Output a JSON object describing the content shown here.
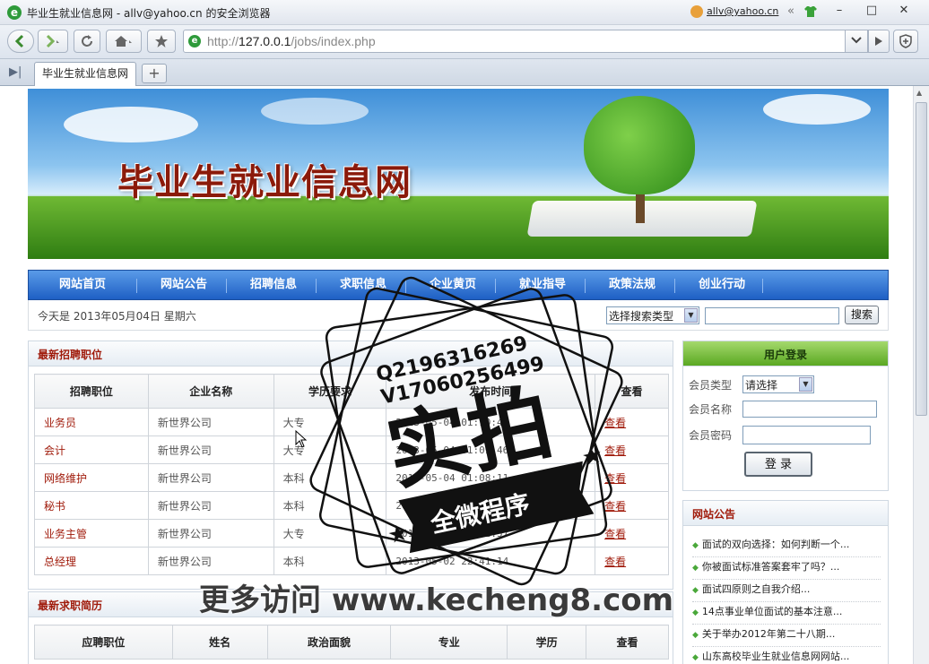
{
  "window": {
    "title": "毕业生就业信息网 - allv@yahoo.cn 的安全浏览器",
    "user_email": "allv@yahoo.cn",
    "collapse_glyph": "«"
  },
  "browser": {
    "url_prefix": "http://",
    "url_host": "127.0.0.1",
    "url_path": "/jobs/index.php",
    "tab_label": "毕业生就业信息网",
    "new_tab_label": "+"
  },
  "site": {
    "banner_title": "毕业生就业信息网",
    "menu": [
      "网站首页",
      "网站公告",
      "招聘信息",
      "求职信息",
      "企业黄页",
      "就业指导",
      "政策法规",
      "创业行动"
    ],
    "today_text": "今天是 2013年05月04日 星期六",
    "search_select": "选择搜索类型",
    "search_button": "搜索"
  },
  "jobs_panel": {
    "title": "最新招聘职位",
    "columns": [
      "招聘职位",
      "企业名称",
      "学历要求",
      "发布时间",
      "查看"
    ],
    "rows": [
      [
        "业务员",
        "新世界公司",
        "大专",
        "2013-05-04 01:10:43",
        "查看"
      ],
      [
        "会计",
        "新世界公司",
        "大专",
        "2013-05-04 01:09:46",
        "查看"
      ],
      [
        "网络维护",
        "新世界公司",
        "本科",
        "2013-05-04 01:08:11",
        "查看"
      ],
      [
        "秘书",
        "新世界公司",
        "本科",
        "2013-05-04 01:08:30",
        "查看"
      ],
      [
        "业务主管",
        "新世界公司",
        "大专",
        "2013-05-02 22:42:57",
        "查看"
      ],
      [
        "总经理",
        "新世界公司",
        "本科",
        "2013-05-02 22:41:14",
        "查看"
      ]
    ]
  },
  "resume_panel": {
    "title": "最新求职简历",
    "columns": [
      "应聘职位",
      "姓名",
      "政治面貌",
      "专业",
      "学历",
      "查看"
    ]
  },
  "login_panel": {
    "title": "用户登录",
    "type_label": "会员类型",
    "type_value": "请选择",
    "name_label": "会员名称",
    "password_label": "会员密码",
    "login_button": "登 录"
  },
  "notice_panel": {
    "title": "网站公告",
    "items": [
      "面试的双向选择：如何判断一个...",
      "你被面试标准答案套牢了吗？...",
      "面试四原则之自我介绍...",
      "14点事业单位面试的基本注意...",
      "关于举办2012年第二十八期...",
      "山东高校毕业生就业信息网网站..."
    ]
  },
  "watermark": {
    "qq": "Q2196316269",
    "vx": "V17060256499",
    "big": "实拍",
    "ribbon": "全微程序",
    "footer": "更多访问 www.kecheng8.com"
  },
  "colors": {
    "accent_red": "#a01b0b",
    "menu_blue": "#1e5fc4",
    "login_green": "#5aa822"
  }
}
